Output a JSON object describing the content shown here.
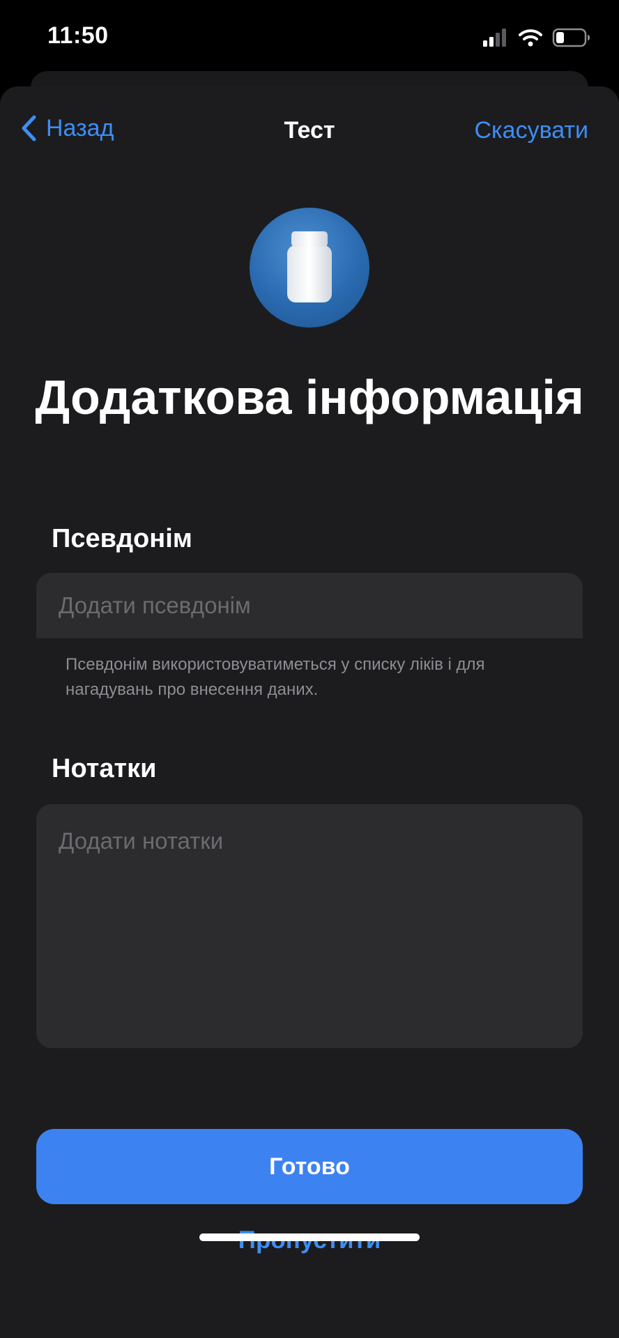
{
  "status_bar": {
    "time": "11:50",
    "icons": [
      "signal-icon",
      "wifi-icon",
      "battery-icon"
    ]
  },
  "nav": {
    "back_label": "Назад",
    "title": "Тест",
    "cancel_label": "Скасувати"
  },
  "header": {
    "icon": "pill-bottle-icon",
    "title": "Додаткова інформація"
  },
  "form": {
    "nickname": {
      "label": "Псевдонім",
      "value": "",
      "placeholder": "Додати псевдонім",
      "footnote": "Псевдонім використовуватиметься у списку ліків і для нагадувань про внесення даних."
    },
    "notes": {
      "label": "Нотатки",
      "value": "",
      "placeholder": "Додати нотатки"
    }
  },
  "actions": {
    "done_label": "Готово",
    "skip_label": "Пропустити"
  },
  "colors": {
    "accent": "#3d8ef5",
    "primary_button": "#3d82f1",
    "sheet_background": "#1c1c1e",
    "field_background": "#2c2c2e"
  }
}
